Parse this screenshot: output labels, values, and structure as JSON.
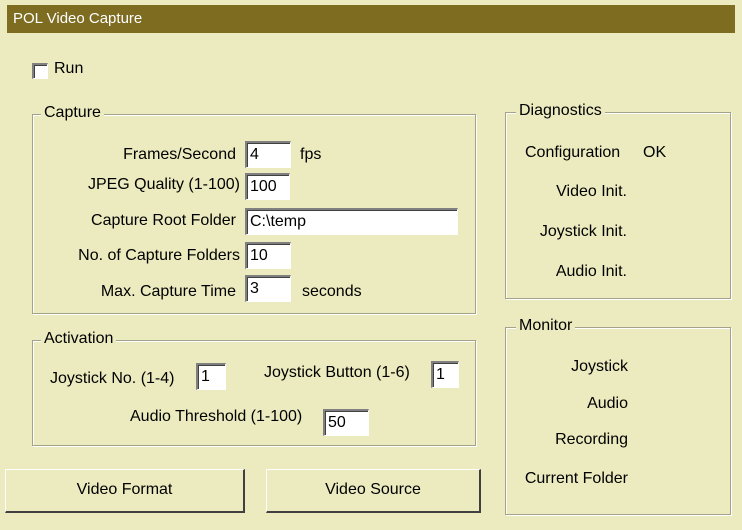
{
  "window": {
    "title": "POL Video Capture"
  },
  "run": {
    "label": "Run",
    "checked": false
  },
  "capture": {
    "legend": "Capture",
    "frames_label": "Frames/Second",
    "frames_value": "4",
    "frames_unit": "fps",
    "jpeg_label": "JPEG Quality (1-100)",
    "jpeg_value": "100",
    "root_label": "Capture Root Folder",
    "root_value": "C:\\temp",
    "folders_label": "No. of Capture Folders",
    "folders_value": "10",
    "maxtime_label": "Max. Capture Time",
    "maxtime_value": "3",
    "maxtime_unit": "seconds"
  },
  "activation": {
    "legend": "Activation",
    "joystick_no_label": "Joystick No. (1-4)",
    "joystick_no_value": "1",
    "joystick_button_label": "Joystick Button (1-6)",
    "joystick_button_value": "1",
    "audio_threshold_label": "Audio Threshold (1-100)",
    "audio_threshold_value": "50"
  },
  "buttons": {
    "video_format": "Video Format",
    "video_source": "Video Source"
  },
  "diagnostics": {
    "legend": "Diagnostics",
    "configuration_label": "Configuration",
    "configuration_status": "OK",
    "video_init_label": "Video Init.",
    "joystick_init_label": "Joystick Init.",
    "audio_init_label": "Audio Init."
  },
  "monitor": {
    "legend": "Monitor",
    "joystick_label": "Joystick",
    "audio_label": "Audio",
    "recording_label": "Recording",
    "current_folder_label": "Current Folder"
  },
  "colors": {
    "background": "#ECEBBF",
    "titlebar": "#7E6C21",
    "titlebar_text": "#FFFFFF"
  }
}
